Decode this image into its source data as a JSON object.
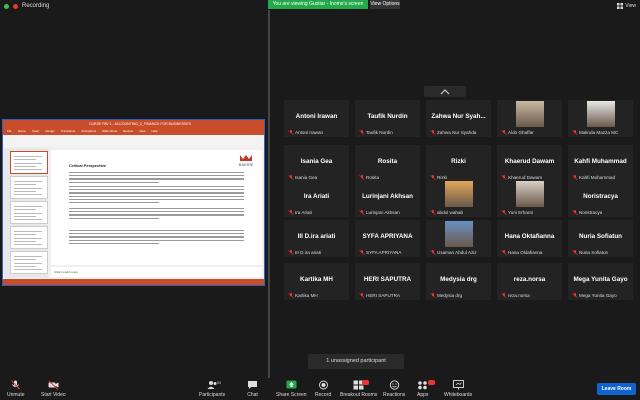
{
  "recording_label": "Recording",
  "banner": {
    "viewing": "You are viewing Gustiar - Inome's screen",
    "view_options": "View Options"
  },
  "view_label": "View",
  "share": {
    "file_title": "CURSE PAV 1 - ACCOUNTING_2_FINANCE FOR BUSINESSES",
    "ribbon_menu": [
      "File",
      "Home",
      "Insert",
      "Design",
      "Transitions",
      "Animations",
      "Slide Show",
      "Review",
      "View",
      "Help"
    ],
    "slide_heading": "Critical Perspective",
    "logo_text": "BAKRIE",
    "notes_text": "Click to add notes"
  },
  "participants": [
    {
      "name": "Antoni Irawan",
      "label": "Antoni Irawan",
      "photo": false
    },
    {
      "name": "Taufik Nurdin",
      "label": "Taufik Nurdin",
      "photo": false
    },
    {
      "name": "Zahwa Nur Syah...",
      "label": "Zahwa Nur Syahda",
      "photo": false
    },
    {
      "name": "",
      "label": "Aldo Ghaffar",
      "photo": true,
      "photo_color": "#c9b9a3"
    },
    {
      "name": "",
      "label": "Malinda Mazza MC",
      "photo": true,
      "photo_color": "#e8e8e8"
    },
    {
      "name": "Isania Gea",
      "label": "Isania Gea",
      "photo": false
    },
    {
      "name": "Rosita",
      "label": "Rosita",
      "photo": false
    },
    {
      "name": "Rizki",
      "label": "Rizki",
      "photo": false
    },
    {
      "name": "Khaerud Dawam",
      "label": "Khaerud Dawam",
      "photo": false
    },
    {
      "name": "Kahfi Muhammad",
      "label": "Kahfi Muhammad",
      "photo": false
    },
    {
      "name": "Ira Ariati",
      "label": "Ira Ariati",
      "photo": false
    },
    {
      "name": "Lurinjani Akhsan",
      "label": "Lurinjani Akhsan",
      "photo": false
    },
    {
      "name": "",
      "label": "abdul wahab",
      "photo": true,
      "photo_color": "#e0a65a"
    },
    {
      "name": "",
      "label": "Yuni Erhanti",
      "photo": true,
      "photo_color": "#d9d0c6"
    },
    {
      "name": "Noristracya",
      "label": "Noristracya",
      "photo": false
    },
    {
      "name": "III D.ira ariati",
      "label": "III D.ira ariati",
      "photo": false
    },
    {
      "name": "SYFA APRIYANA",
      "label": "SYFA APRIYANA",
      "photo": false
    },
    {
      "name": "",
      "label": "Usaman Abdul Aziz",
      "photo": true,
      "photo_color": "#6a8fc4"
    },
    {
      "name": "Hana Oktafianna",
      "label": "Hana Oldafianna",
      "photo": false
    },
    {
      "name": "Nuria Sofiatun",
      "label": "Nuria Sofiatun",
      "photo": false
    },
    {
      "name": "Kartika MH",
      "label": "Kartika MH",
      "photo": false
    },
    {
      "name": "HERI SAPUTRA",
      "label": "HERI SAPUTRA",
      "photo": false
    },
    {
      "name": "Medysia drg",
      "label": "Medysia drg",
      "photo": false
    },
    {
      "name": "reza.norsa",
      "label": "reza.norsa",
      "photo": false
    },
    {
      "name": "Mega Yunita Gayo",
      "label": "Mega Yunita Gayo",
      "photo": false
    }
  ],
  "unassigned": "1 unassigned participant",
  "toolbar": {
    "unmute": "Unmute",
    "start_video": "Start Video",
    "participants": "Participants",
    "participants_count": "53",
    "chat": "Chat",
    "share_screen": "Share Screen",
    "record": "Record",
    "breakout_rooms": "Breakout Rooms",
    "reactions": "Reactions",
    "apps": "Apps",
    "whiteboards": "Whiteboards",
    "leave_room": "Leave Room"
  },
  "colors": {
    "share_green": "#23a84c",
    "leave_blue": "#1164d0",
    "muted_red": "#e33333",
    "ppt_orange": "#c94d2a"
  }
}
